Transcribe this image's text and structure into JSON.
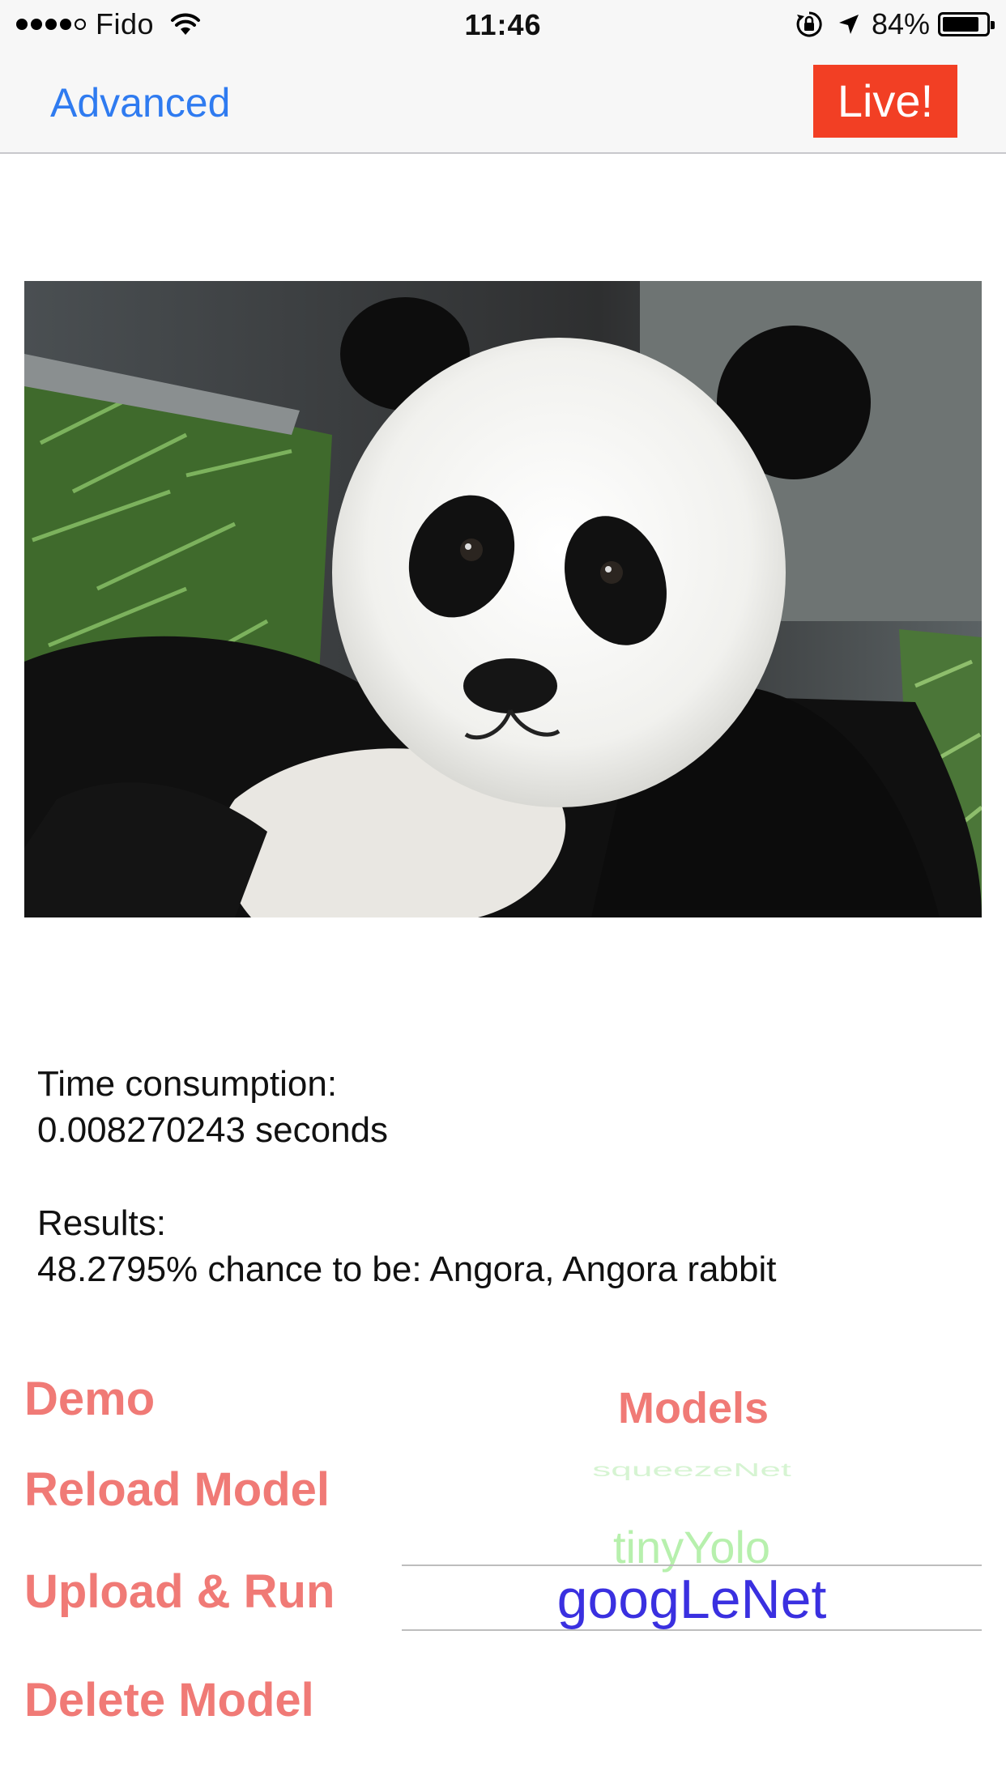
{
  "status_bar": {
    "carrier": "Fido",
    "time": "11:46",
    "battery_percent": "84%",
    "battery_level": 0.84,
    "signal_bars_filled": 4,
    "signal_bars_total": 5,
    "icons": [
      "wifi-icon",
      "rotation-lock-icon",
      "location-arrow-icon",
      "battery-icon"
    ]
  },
  "nav": {
    "left_label": "Advanced",
    "right_label": "Live!",
    "colors": {
      "link": "#2f7bf0",
      "live_bg": "#f23f24"
    }
  },
  "image": {
    "subject": "panda-photo"
  },
  "results": {
    "time_label": "Time consumption:",
    "time_value": "0.008270243 seconds",
    "results_label": "Results:",
    "results_value": "48.2795% chance to be: Angora, Angora rabbit"
  },
  "actions": {
    "demo": "Demo",
    "reload": "Reload Model",
    "upload": "Upload & Run",
    "delete": "Delete Model",
    "color": "#f07a76"
  },
  "models": {
    "title": "Models",
    "items": [
      "squeezeNet",
      "tinyYolo",
      "googLeNet"
    ],
    "selected": "googLeNet",
    "colors": {
      "selected": "#3a30e0",
      "unselected": "#b7f0ad"
    }
  }
}
